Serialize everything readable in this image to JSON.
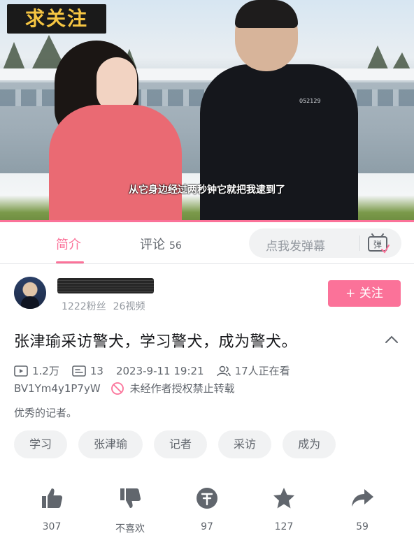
{
  "video": {
    "watermark": "求关注",
    "subtitle": "从它身边经过两秒钟它就把我逮到了",
    "badge_number": "052129"
  },
  "tabs": [
    {
      "label": "简介",
      "active": true
    },
    {
      "label": "评论",
      "count": "56",
      "active": false
    }
  ],
  "danmaku": {
    "placeholder": "点我发弹幕",
    "icon": "danmaku-icon"
  },
  "uploader": {
    "followers": "1222粉丝",
    "videos": "26视频",
    "follow_label": "+ 关注"
  },
  "video_info": {
    "title": "张津瑜采访警犬，学习警犬，成为警犬。",
    "plays": "1.2万",
    "danmaku_count": "13",
    "datetime": "2023-9-11 19:21",
    "watching": "17人正在看",
    "bvid": "BV1Ym4y1P7yW",
    "copyright": "未经作者授权禁止转载",
    "description": "优秀的记者。"
  },
  "tags": [
    "学习",
    "张津瑜",
    "记者",
    "采访",
    "成为"
  ],
  "actions": [
    {
      "name": "like",
      "icon": "thumb-up-icon",
      "label": "307"
    },
    {
      "name": "dislike",
      "icon": "thumb-down-icon",
      "label": "不喜欢"
    },
    {
      "name": "coin",
      "icon": "coin-icon",
      "label": "97"
    },
    {
      "name": "favorite",
      "icon": "star-icon",
      "label": "127"
    },
    {
      "name": "share",
      "icon": "share-icon",
      "label": "59"
    }
  ],
  "colors": {
    "accent": "#fb7299",
    "text": "#18191c",
    "secondary": "#61666d",
    "muted": "#9499a0",
    "chip": "#f1f2f3"
  }
}
